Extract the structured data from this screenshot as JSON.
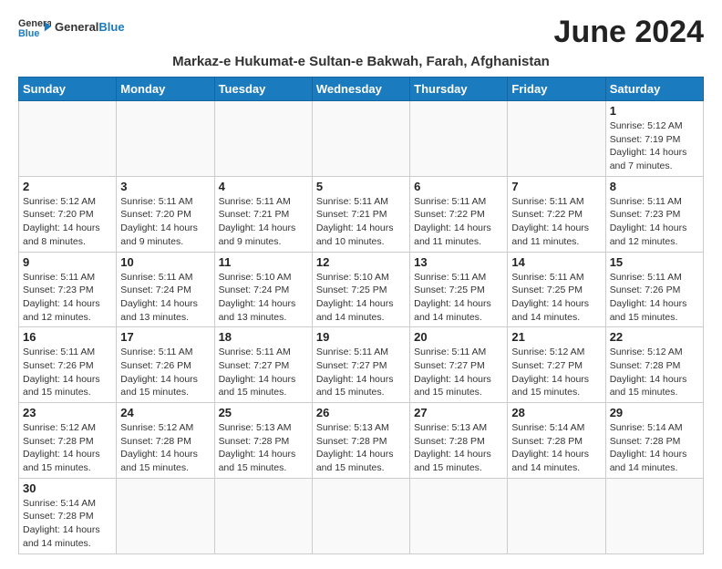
{
  "header": {
    "logo_general": "General",
    "logo_blue": "Blue",
    "month_title": "June 2024",
    "location": "Markaz-e Hukumat-e Sultan-e Bakwah, Farah, Afghanistan"
  },
  "days_of_week": [
    "Sunday",
    "Monday",
    "Tuesday",
    "Wednesday",
    "Thursday",
    "Friday",
    "Saturday"
  ],
  "weeks": [
    [
      {
        "day": "",
        "info": ""
      },
      {
        "day": "",
        "info": ""
      },
      {
        "day": "",
        "info": ""
      },
      {
        "day": "",
        "info": ""
      },
      {
        "day": "",
        "info": ""
      },
      {
        "day": "",
        "info": ""
      },
      {
        "day": "1",
        "info": "Sunrise: 5:12 AM\nSunset: 7:19 PM\nDaylight: 14 hours and 7 minutes."
      }
    ],
    [
      {
        "day": "2",
        "info": "Sunrise: 5:12 AM\nSunset: 7:20 PM\nDaylight: 14 hours and 8 minutes."
      },
      {
        "day": "3",
        "info": "Sunrise: 5:11 AM\nSunset: 7:20 PM\nDaylight: 14 hours and 9 minutes."
      },
      {
        "day": "4",
        "info": "Sunrise: 5:11 AM\nSunset: 7:21 PM\nDaylight: 14 hours and 9 minutes."
      },
      {
        "day": "5",
        "info": "Sunrise: 5:11 AM\nSunset: 7:21 PM\nDaylight: 14 hours and 10 minutes."
      },
      {
        "day": "6",
        "info": "Sunrise: 5:11 AM\nSunset: 7:22 PM\nDaylight: 14 hours and 11 minutes."
      },
      {
        "day": "7",
        "info": "Sunrise: 5:11 AM\nSunset: 7:22 PM\nDaylight: 14 hours and 11 minutes."
      },
      {
        "day": "8",
        "info": "Sunrise: 5:11 AM\nSunset: 7:23 PM\nDaylight: 14 hours and 12 minutes."
      }
    ],
    [
      {
        "day": "9",
        "info": "Sunrise: 5:11 AM\nSunset: 7:23 PM\nDaylight: 14 hours and 12 minutes."
      },
      {
        "day": "10",
        "info": "Sunrise: 5:11 AM\nSunset: 7:24 PM\nDaylight: 14 hours and 13 minutes."
      },
      {
        "day": "11",
        "info": "Sunrise: 5:10 AM\nSunset: 7:24 PM\nDaylight: 14 hours and 13 minutes."
      },
      {
        "day": "12",
        "info": "Sunrise: 5:10 AM\nSunset: 7:25 PM\nDaylight: 14 hours and 14 minutes."
      },
      {
        "day": "13",
        "info": "Sunrise: 5:11 AM\nSunset: 7:25 PM\nDaylight: 14 hours and 14 minutes."
      },
      {
        "day": "14",
        "info": "Sunrise: 5:11 AM\nSunset: 7:25 PM\nDaylight: 14 hours and 14 minutes."
      },
      {
        "day": "15",
        "info": "Sunrise: 5:11 AM\nSunset: 7:26 PM\nDaylight: 14 hours and 15 minutes."
      }
    ],
    [
      {
        "day": "16",
        "info": "Sunrise: 5:11 AM\nSunset: 7:26 PM\nDaylight: 14 hours and 15 minutes."
      },
      {
        "day": "17",
        "info": "Sunrise: 5:11 AM\nSunset: 7:26 PM\nDaylight: 14 hours and 15 minutes."
      },
      {
        "day": "18",
        "info": "Sunrise: 5:11 AM\nSunset: 7:27 PM\nDaylight: 14 hours and 15 minutes."
      },
      {
        "day": "19",
        "info": "Sunrise: 5:11 AM\nSunset: 7:27 PM\nDaylight: 14 hours and 15 minutes."
      },
      {
        "day": "20",
        "info": "Sunrise: 5:11 AM\nSunset: 7:27 PM\nDaylight: 14 hours and 15 minutes."
      },
      {
        "day": "21",
        "info": "Sunrise: 5:12 AM\nSunset: 7:27 PM\nDaylight: 14 hours and 15 minutes."
      },
      {
        "day": "22",
        "info": "Sunrise: 5:12 AM\nSunset: 7:28 PM\nDaylight: 14 hours and 15 minutes."
      }
    ],
    [
      {
        "day": "23",
        "info": "Sunrise: 5:12 AM\nSunset: 7:28 PM\nDaylight: 14 hours and 15 minutes."
      },
      {
        "day": "24",
        "info": "Sunrise: 5:12 AM\nSunset: 7:28 PM\nDaylight: 14 hours and 15 minutes."
      },
      {
        "day": "25",
        "info": "Sunrise: 5:13 AM\nSunset: 7:28 PM\nDaylight: 14 hours and 15 minutes."
      },
      {
        "day": "26",
        "info": "Sunrise: 5:13 AM\nSunset: 7:28 PM\nDaylight: 14 hours and 15 minutes."
      },
      {
        "day": "27",
        "info": "Sunrise: 5:13 AM\nSunset: 7:28 PM\nDaylight: 14 hours and 15 minutes."
      },
      {
        "day": "28",
        "info": "Sunrise: 5:14 AM\nSunset: 7:28 PM\nDaylight: 14 hours and 14 minutes."
      },
      {
        "day": "29",
        "info": "Sunrise: 5:14 AM\nSunset: 7:28 PM\nDaylight: 14 hours and 14 minutes."
      }
    ],
    [
      {
        "day": "30",
        "info": "Sunrise: 5:14 AM\nSunset: 7:28 PM\nDaylight: 14 hours and 14 minutes."
      },
      {
        "day": "",
        "info": ""
      },
      {
        "day": "",
        "info": ""
      },
      {
        "day": "",
        "info": ""
      },
      {
        "day": "",
        "info": ""
      },
      {
        "day": "",
        "info": ""
      },
      {
        "day": "",
        "info": ""
      }
    ]
  ]
}
